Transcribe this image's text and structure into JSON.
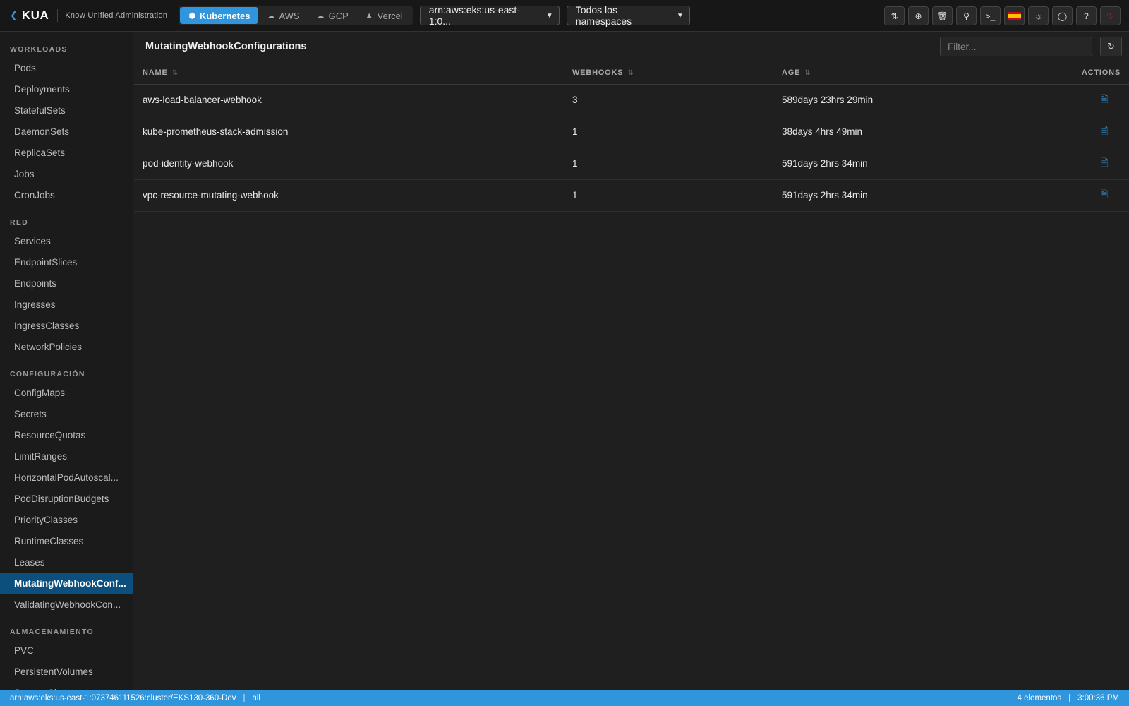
{
  "app": {
    "logo": "KUA",
    "subtitle": "Know Unified Administration"
  },
  "providers": [
    {
      "label": "Kubernetes",
      "icon": "cube-icon",
      "active": true
    },
    {
      "label": "AWS",
      "icon": "cloud-icon",
      "active": false
    },
    {
      "label": "GCP",
      "icon": "cloud-icon",
      "active": false
    },
    {
      "label": "Vercel",
      "icon": "triangle-icon",
      "active": false
    }
  ],
  "selectors": {
    "cluster": "arn:aws:eks:us-east-1:0...",
    "namespace": "Todos los namespaces"
  },
  "toolbar_icons": [
    "compare-icon",
    "add-icon",
    "trash-icon",
    "key-icon",
    "terminal-icon",
    "spain-flag-icon",
    "sun-icon",
    "shield-icon",
    "help-icon",
    "heart-icon"
  ],
  "sidebar": {
    "sections": [
      {
        "title": "WORKLOADS",
        "items": [
          "Pods",
          "Deployments",
          "StatefulSets",
          "DaemonSets",
          "ReplicaSets",
          "Jobs",
          "CronJobs"
        ]
      },
      {
        "title": "RED",
        "items": [
          "Services",
          "EndpointSlices",
          "Endpoints",
          "Ingresses",
          "IngressClasses",
          "NetworkPolicies"
        ]
      },
      {
        "title": "CONFIGURACIÓN",
        "items": [
          "ConfigMaps",
          "Secrets",
          "ResourceQuotas",
          "LimitRanges",
          "HorizontalPodAutoscal...",
          "PodDisruptionBudgets",
          "PriorityClasses",
          "RuntimeClasses",
          "Leases",
          "MutatingWebhookConf...",
          "ValidatingWebhookCon..."
        ]
      },
      {
        "title": "ALMACENAMIENTO",
        "items": [
          "PVC",
          "PersistentVolumes",
          "StorageClasses"
        ]
      }
    ],
    "active": "MutatingWebhookConf..."
  },
  "main": {
    "title": "MutatingWebhookConfigurations",
    "filter_placeholder": "Filter...",
    "columns": [
      "NAME",
      "WEBHOOKS",
      "AGE",
      "ACTIONS"
    ],
    "rows": [
      {
        "name": "aws-load-balancer-webhook",
        "webhooks": "3",
        "age": "589days 23hrs 29min"
      },
      {
        "name": "kube-prometheus-stack-admission",
        "webhooks": "1",
        "age": "38days 4hrs 49min"
      },
      {
        "name": "pod-identity-webhook",
        "webhooks": "1",
        "age": "591days 2hrs 34min"
      },
      {
        "name": "vpc-resource-mutating-webhook",
        "webhooks": "1",
        "age": "591days 2hrs 34min"
      }
    ]
  },
  "statusbar": {
    "cluster": "arn:aws:eks:us-east-1:073746111526:cluster/EKS130-360-Dev",
    "namespace": "all",
    "count": "4 elementos",
    "time": "3:00:36 PM"
  },
  "colors": {
    "accent": "#2f95dc",
    "sidebar_active": "#0d4f7c",
    "background": "#1f1f1f"
  }
}
